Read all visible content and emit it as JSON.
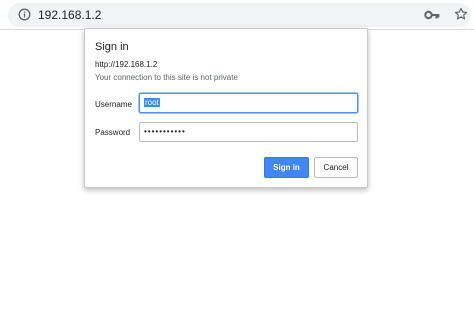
{
  "browser": {
    "url": "192.168.1.2",
    "info_icon": "info-icon",
    "key_icon": "key-icon",
    "star_icon": "star-icon"
  },
  "dialog": {
    "title": "Sign in",
    "origin": "http://192.168.1.2",
    "warning": "Your connection to this site is not private",
    "username_label": "Username",
    "username_value": "root",
    "password_label": "Password",
    "password_masked": "•••••••••••",
    "signin_label": "Sign in",
    "cancel_label": "Cancel"
  },
  "colors": {
    "accent": "#4285f4",
    "focus_ring": "#4d90fe",
    "selection": "#3390ff"
  }
}
